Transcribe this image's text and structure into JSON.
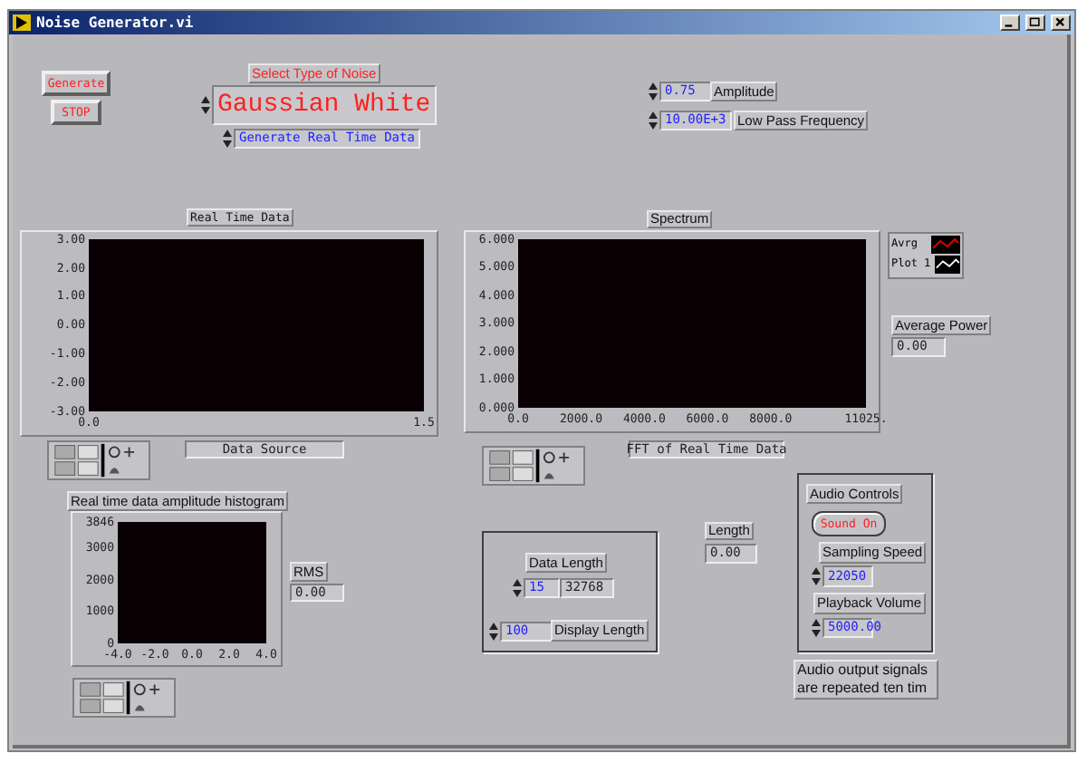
{
  "window": {
    "title": "Noise Generator.vi"
  },
  "buttons": [
    {
      "label": "Generate"
    },
    {
      "label": "STOP"
    }
  ],
  "noise_type": {
    "label": "Select Type of Noise",
    "value": "Gaussian White"
  },
  "data_mode": {
    "value": "Generate Real Time Data"
  },
  "amplitude": {
    "label": "Amplitude",
    "value": "0.75"
  },
  "low_pass_frequency": {
    "label": "Low Pass Frequency",
    "value": "10.00E+3"
  },
  "graphs": [
    {
      "title": "Real Time Data",
      "y_ticks": [
        "3.00",
        "2.00",
        "1.00",
        "0.00",
        "-1.00",
        "-2.00",
        "-3.00"
      ],
      "x_ticks": [
        "0.0",
        "1.5"
      ],
      "caption": "Data Source"
    },
    {
      "title": "Spectrum",
      "y_ticks": [
        "6.000",
        "5.000",
        "4.000",
        "3.000",
        "2.000",
        "1.000",
        "0.000"
      ],
      "x_ticks": [
        "0.0",
        "2000.0",
        "4000.0",
        "6000.0",
        "8000.0",
        "11025."
      ],
      "caption": "FFT of Real Time Data"
    },
    {
      "title": "Real time data amplitude histogram",
      "y_ticks": [
        "3846",
        "3000",
        "2000",
        "1000",
        "0"
      ],
      "x_ticks": [
        "-4.0",
        "-2.0",
        "0.0",
        "2.0",
        "4.0"
      ]
    }
  ],
  "legend": [
    {
      "name": "Avrg",
      "color": "#e00000"
    },
    {
      "name": "Plot 1",
      "color": "#ffffff"
    }
  ],
  "average_power": {
    "label": "Average Power",
    "value": "0.00"
  },
  "rms": {
    "label": "RMS",
    "value": "0.00"
  },
  "data_length": {
    "label": "Data Length",
    "exponent": "15",
    "value": "32768",
    "display_label": "Display Length",
    "display_value": "100"
  },
  "length": {
    "label": "Length",
    "value": "0.00"
  },
  "audio_controls": {
    "label": "Audio Controls",
    "button": "Sound On",
    "sampling_label": "Sampling Speed",
    "sampling_value": "22050",
    "volume_label": "Playback Volume",
    "volume_value": "5000.00"
  },
  "note": "Audio output signals are repeated ten tim"
}
